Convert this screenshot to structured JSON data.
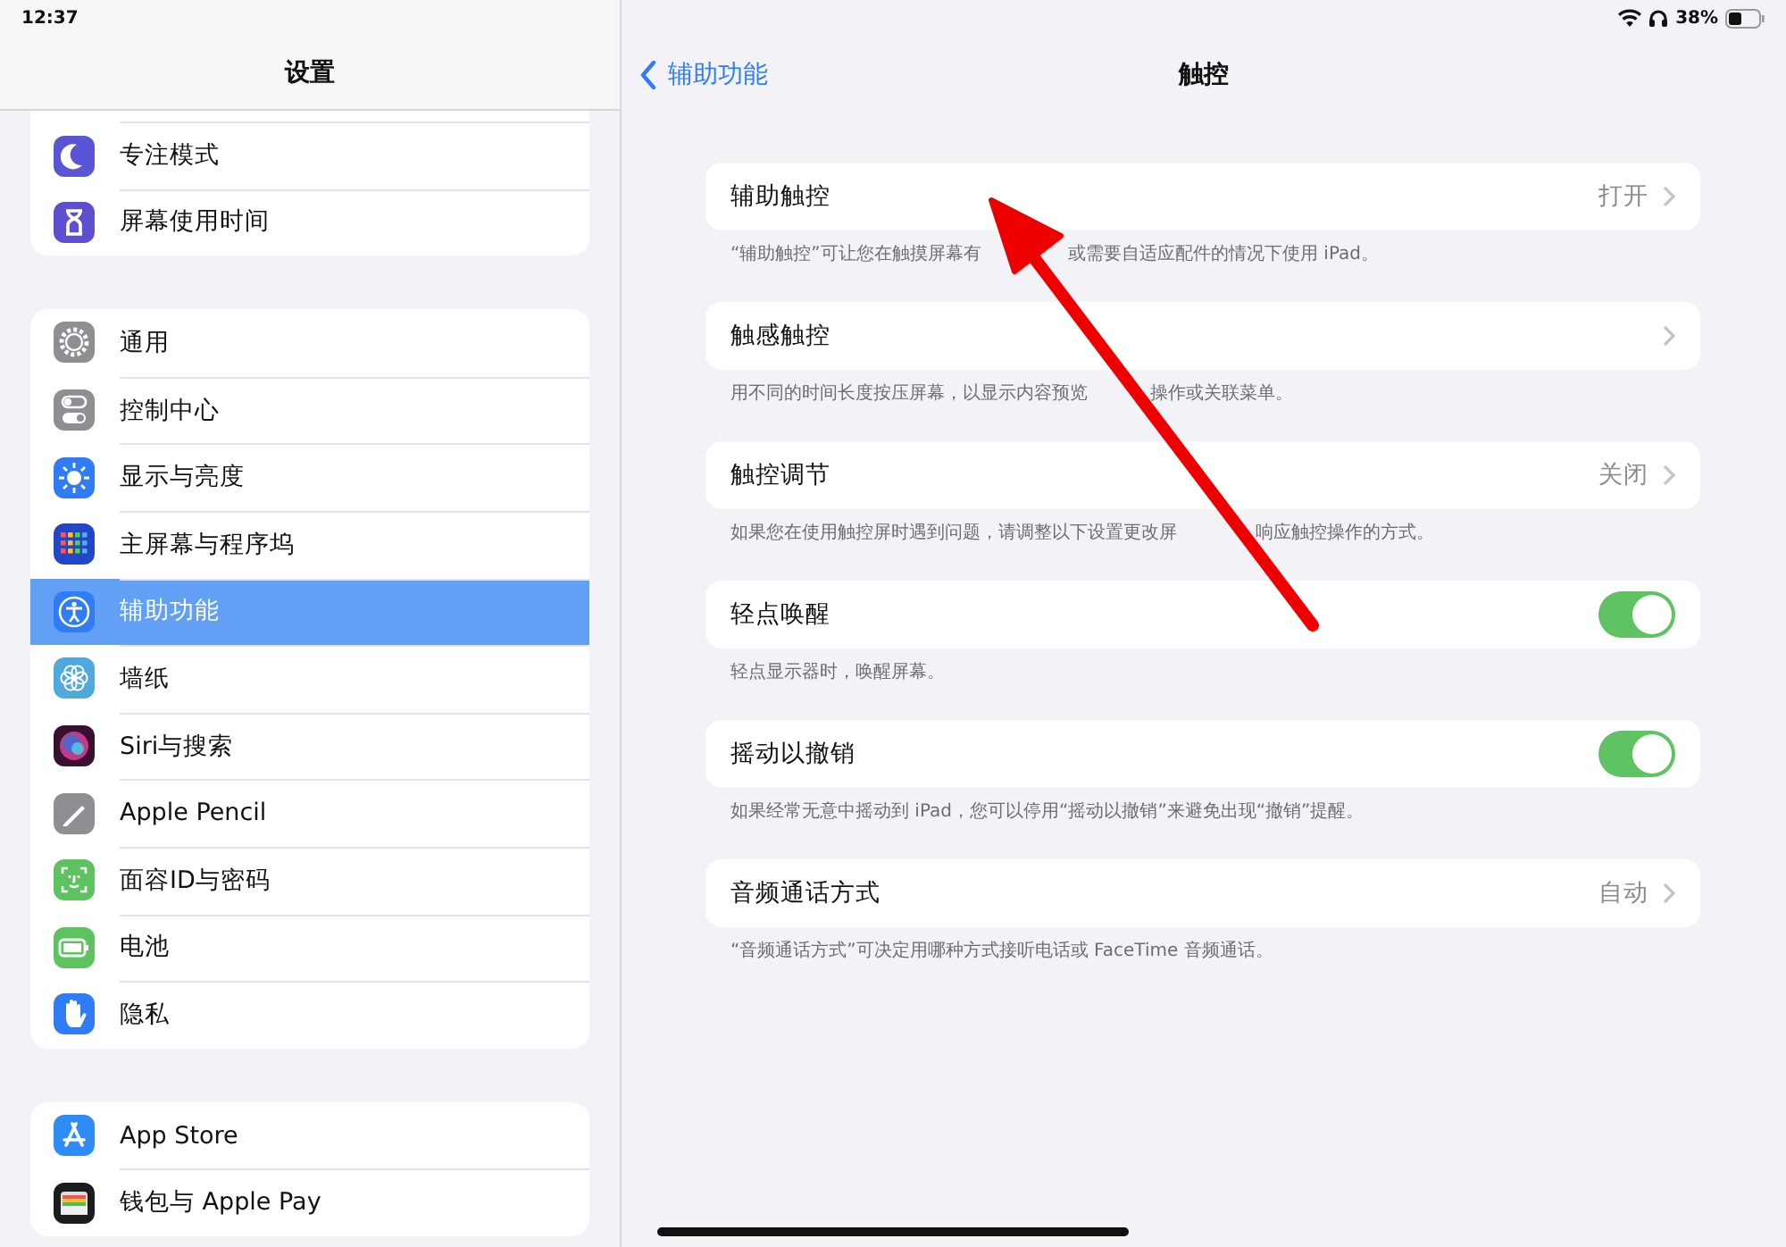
{
  "status_bar": {
    "time": "12:37",
    "battery": "38%"
  },
  "sidebar": {
    "title": "设置",
    "groups": [
      {
        "items": [
          {
            "label": "专注模式",
            "kind": "moon",
            "selected": false
          },
          {
            "label": "屏幕使用时间",
            "kind": "hourglass",
            "selected": false
          }
        ]
      },
      {
        "items": [
          {
            "label": "通用",
            "kind": "gear",
            "selected": false
          },
          {
            "label": "控制中心",
            "kind": "switches",
            "selected": false
          },
          {
            "label": "显示与亮度",
            "kind": "sun",
            "selected": false
          },
          {
            "label": "主屏幕与程序坞",
            "kind": "grid",
            "selected": false
          },
          {
            "label": "辅助功能",
            "kind": "accessibility",
            "selected": true
          },
          {
            "label": "墙纸",
            "kind": "flower",
            "selected": false
          },
          {
            "label": "Siri与搜索",
            "kind": "orb",
            "selected": false
          },
          {
            "label": "Apple Pencil",
            "kind": "pencil",
            "selected": false
          },
          {
            "label": "面容ID与密码",
            "kind": "face",
            "selected": false
          },
          {
            "label": "电池",
            "kind": "battery",
            "selected": false
          },
          {
            "label": "隐私",
            "kind": "hand",
            "selected": false
          }
        ]
      },
      {
        "items": [
          {
            "label": "App Store",
            "kind": "appstore",
            "selected": false
          },
          {
            "label": "钱包与 Apple Pay",
            "kind": "wallet",
            "selected": false
          }
        ]
      }
    ]
  },
  "detail": {
    "back": "辅助功能",
    "title": "触控",
    "rows": [
      {
        "kind": "link",
        "label": "辅助触控",
        "value": "打开",
        "note_parts": [
          "“辅助触控”可让您在触摸屏幕有",
          "或需要自适应配件的情况下使用 iPad。"
        ]
      },
      {
        "kind": "link",
        "label": "触感触控",
        "note_parts": [
          "用不同的时间长度按压屏幕，以显示内容预览",
          "操作或关联菜单。"
        ]
      },
      {
        "kind": "link",
        "label": "触控调节",
        "value": "关闭",
        "note_parts": [
          "如果您在使用触控屏时遇到问题，请调整以下设置更改屏",
          "响应触控操作的方式。"
        ]
      },
      {
        "kind": "toggle",
        "label": "轻点唤醒",
        "on": true,
        "note_parts": [
          "轻点显示器时，唤醒屏幕。"
        ]
      },
      {
        "kind": "toggle",
        "label": "摇动以撤销",
        "on": true,
        "note_parts": [
          "如果经常无意中摇动到 iPad，您可以停用“摇动以撤销”来避免出现“撤销”提醒。"
        ]
      },
      {
        "kind": "link",
        "label": "音频通话方式",
        "value": "自动",
        "note_parts": [
          "“音频通话方式”可决定用哪种方式接听电话或 FaceTime 音频通话。"
        ]
      }
    ]
  }
}
